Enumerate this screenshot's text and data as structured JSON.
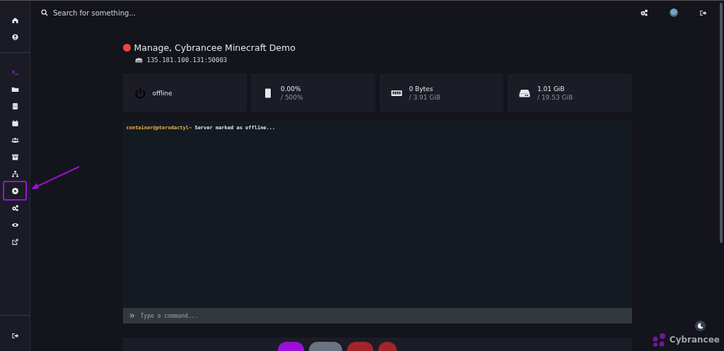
{
  "sidebar": {
    "top_items": [
      {
        "kind": "home",
        "selected": false
      },
      {
        "kind": "account",
        "selected": false
      }
    ],
    "items": [
      {
        "kind": "console",
        "selected": true,
        "highlighted": false
      },
      {
        "kind": "files",
        "selected": false,
        "highlighted": false
      },
      {
        "kind": "databases",
        "selected": false,
        "highlighted": false
      },
      {
        "kind": "schedules",
        "selected": false,
        "highlighted": false
      },
      {
        "kind": "users",
        "selected": false,
        "highlighted": false
      },
      {
        "kind": "backups",
        "selected": false,
        "highlighted": false
      },
      {
        "kind": "network",
        "selected": false,
        "highlighted": false
      },
      {
        "kind": "startup",
        "selected": false,
        "highlighted": true
      },
      {
        "kind": "settings",
        "selected": false,
        "highlighted": false
      },
      {
        "kind": "activity",
        "selected": false,
        "highlighted": false
      },
      {
        "kind": "external",
        "selected": false,
        "highlighted": false
      }
    ],
    "bottom_items": [
      {
        "kind": "logout",
        "selected": false
      }
    ]
  },
  "top_bar": {
    "search": {
      "placeholder": "Search for something..."
    }
  },
  "server": {
    "status": {
      "kind": "offline"
    },
    "title": "Manage, Cybrancee Minecraft Demo",
    "address": "135.181.100.131:50003"
  },
  "stats": [
    {
      "kind": "power",
      "value": "offline"
    },
    {
      "kind": "cpu",
      "value": "0.00%",
      "limit": "/ 500%"
    },
    {
      "kind": "memory",
      "value": "0 Bytes",
      "limit": "/ 3.91 GiB"
    },
    {
      "kind": "disk",
      "value": "1.01 GiB",
      "limit": "/ 19.53 GiB"
    }
  ],
  "console": {
    "lines": [
      {
        "prompt": "container@pterodactyl~",
        "text": "Server marked as offline..."
      }
    ],
    "input": {
      "placeholder": "Type a command..."
    }
  },
  "power_buttons": [
    {
      "color": "#9b10d8"
    },
    {
      "color": "#6b7280"
    },
    {
      "color": "#a3242d"
    },
    {
      "color": "#a3242d"
    }
  ],
  "brand": {
    "name": "Cybrancee"
  }
}
